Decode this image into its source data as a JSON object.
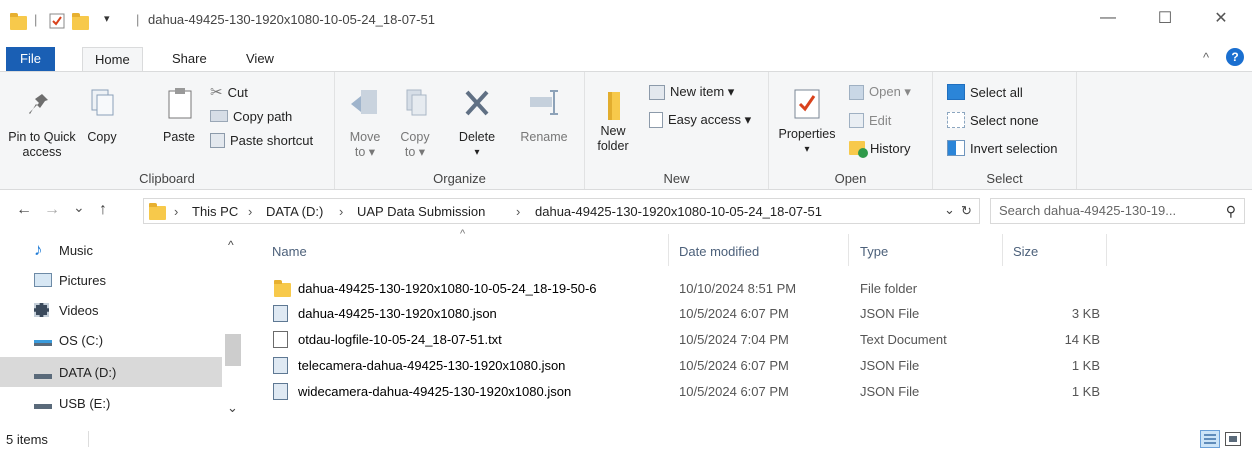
{
  "window": {
    "title": "dahua-49425-130-1920x1080-10-05-24_18-07-51",
    "min_glyph": "—",
    "max_glyph": "☐",
    "close_glyph": "✕"
  },
  "ribbon_tabs": [
    {
      "label": "File"
    },
    {
      "label": "Home"
    },
    {
      "label": "Share"
    },
    {
      "label": "View"
    }
  ],
  "ribbon_util": {
    "collapse_glyph": "^",
    "help_glyph": "?"
  },
  "clipboard": {
    "group_label": "Clipboard",
    "pin_label_1": "Pin to Quick",
    "pin_label_2": "access",
    "copy_label": "Copy",
    "paste_label": "Paste",
    "cut_label": "Cut",
    "copy_path_label": "Copy path",
    "paste_shortcut_label": "Paste shortcut"
  },
  "organize": {
    "group_label": "Organize",
    "move_to_1": "Move",
    "move_to_2": "to ▾",
    "copy_to_1": "Copy",
    "copy_to_2": "to ▾",
    "delete_label": "Delete",
    "delete_arrow": "▾",
    "rename_label": "Rename"
  },
  "new": {
    "group_label": "New",
    "new_folder_1": "New",
    "new_folder_2": "folder",
    "new_item_label": "New item ▾",
    "easy_access_label": "Easy access ▾"
  },
  "open": {
    "group_label": "Open",
    "properties_label": "Properties",
    "properties_arrow": "▾",
    "open_label": "Open ▾",
    "edit_label": "Edit",
    "history_label": "History"
  },
  "select": {
    "group_label": "Select",
    "select_all_label": "Select all",
    "select_none_label": "Select none",
    "invert_selection_label": "Invert selection"
  },
  "address": {
    "back_glyph": "←",
    "forward_glyph": "→",
    "recent_glyph": "⌄",
    "up_glyph": "↑",
    "crumbs": [
      {
        "label": "This PC"
      },
      {
        "label": "DATA (D:)"
      },
      {
        "label": "UAP Data Submission"
      },
      {
        "label": "dahua-49425-130-1920x1080-10-05-24_18-07-51"
      }
    ],
    "separator": "›",
    "dropdown_glyph": "⌄",
    "refresh_glyph": "↻",
    "search_placeholder": "Search dahua-49425-130-19...",
    "search_glyph": "⚲"
  },
  "nav": {
    "items": [
      {
        "label": "Music"
      },
      {
        "label": "Pictures"
      },
      {
        "label": "Videos"
      },
      {
        "label": "OS (C:)"
      },
      {
        "label": "DATA (D:)"
      },
      {
        "label": "USB (E:)"
      }
    ],
    "selected_index": 4,
    "scroll_up_glyph": "^",
    "scroll_down_glyph": "⌄"
  },
  "file_list": {
    "sort_glyph": "^",
    "columns": {
      "name": "Name",
      "date": "Date modified",
      "type": "Type",
      "size": "Size"
    },
    "rows": [
      {
        "name": "dahua-49425-130-1920x1080-10-05-24_18-19-50-6",
        "date": "10/10/2024 8:51 PM",
        "type": "File folder",
        "size": "",
        "icon": "folder-icon"
      },
      {
        "name": "dahua-49425-130-1920x1080.json",
        "date": "10/5/2024 6:07 PM",
        "type": "JSON File",
        "size": "3 KB",
        "icon": "json-file-icon"
      },
      {
        "name": "otdau-logfile-10-05-24_18-07-51.txt",
        "date": "10/5/2024 7:04 PM",
        "type": "Text Document",
        "size": "14 KB",
        "icon": "text-file-icon"
      },
      {
        "name": "telecamera-dahua-49425-130-1920x1080.json",
        "date": "10/5/2024 6:07 PM",
        "type": "JSON File",
        "size": "1 KB",
        "icon": "json-file-icon"
      },
      {
        "name": "widecamera-dahua-49425-130-1920x1080.json",
        "date": "10/5/2024 6:07 PM",
        "type": "JSON File",
        "size": "1 KB",
        "icon": "json-file-icon"
      }
    ]
  },
  "status": {
    "item_count": "5 items"
  },
  "colors": {
    "file_tab": "#1a5fb4",
    "folder": "#f7c94b",
    "selected_nav": "#d9d9d9",
    "column_header": "#4c607a"
  }
}
